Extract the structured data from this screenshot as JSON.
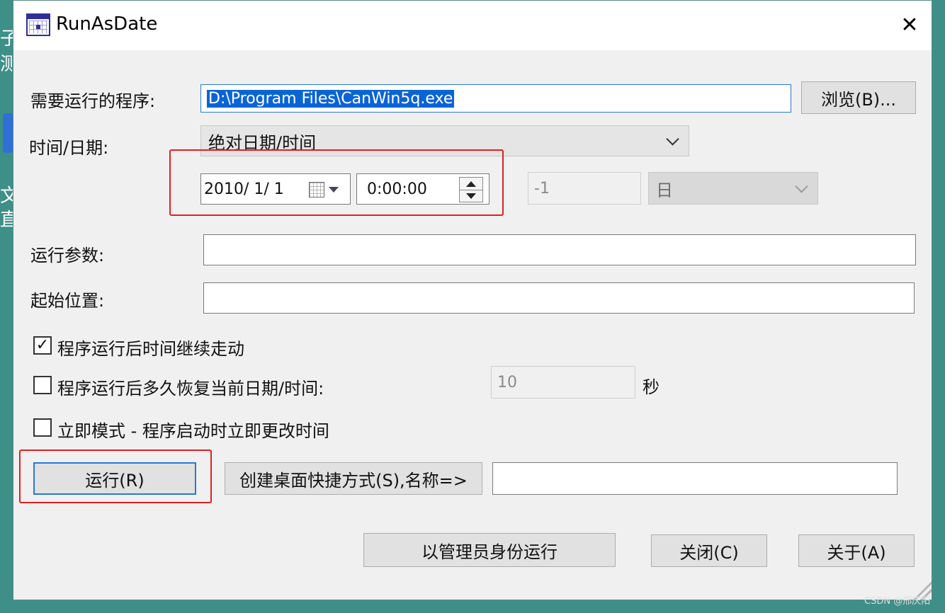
{
  "background": {
    "fragments": [
      "子",
      "测",
      "文",
      "直"
    ]
  },
  "window": {
    "title": "RunAsDate",
    "close_glyph": "✕"
  },
  "program": {
    "label": "需要运行的程序:",
    "value": "D:\\Program Files\\CanWin5q.exe",
    "browse_label": "浏览(B)..."
  },
  "datetime": {
    "label": "时间/日期:",
    "mode_selected": "绝对日期/时间",
    "date_value": "2010/  1/  1",
    "time_value": "0:00:00",
    "offset_value": "-1",
    "unit_selected": "日"
  },
  "params": {
    "label": "运行参数:",
    "value": ""
  },
  "start_location": {
    "label": "起始位置:",
    "value": ""
  },
  "options": {
    "keep_running": {
      "label": "程序运行后时间继续走动",
      "checked": true,
      "check_glyph": "✓"
    },
    "restore_after": {
      "label": "程序运行后多久恢复当前日期/时间:",
      "checked": false,
      "seconds_value": "10",
      "seconds_unit": "秒"
    },
    "immediate_mode": {
      "label": "立即模式 - 程序启动时立即更改时间",
      "checked": false
    }
  },
  "actions": {
    "run_label": "运行(R)",
    "shortcut_label": "创建桌面快捷方式(S),名称=>",
    "shortcut_name_value": "",
    "admin_run_label": "以管理员身份运行",
    "close_label": "关闭(C)",
    "about_label": "关于(A)"
  },
  "watermark": "CSDN @邢庆阳",
  "colors": {
    "highlight": "#e02020",
    "selection": "#0a64d6",
    "desktop": "#3e8f88"
  }
}
